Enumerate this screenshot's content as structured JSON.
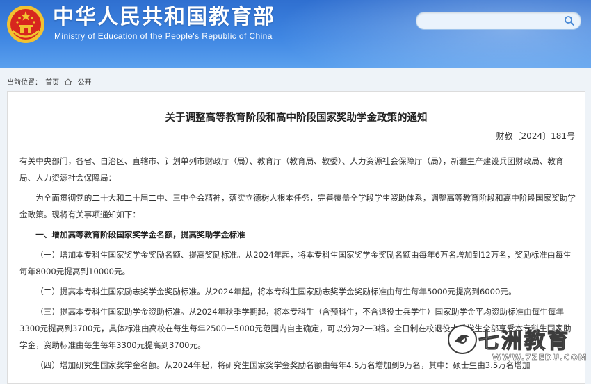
{
  "header": {
    "site_title": "中华人民共和国教育部",
    "site_subtitle": "Ministry of Education of the People's Republic of China",
    "search_placeholder": ""
  },
  "breadcrumb": {
    "prefix": "当前位置：",
    "home": "首页",
    "current": "公开"
  },
  "article": {
    "title": "关于调整高等教育阶段和高中阶段国家奖助学金政策的通知",
    "doc_number": "财教〔2024〕181号",
    "addressee": "有关中央部门，各省、自治区、直辖市、计划单列市财政厅（局）、教育厅（教育局、教委）、人力资源社会保障厅（局），新疆生产建设兵团财政局、教育局、人力资源社会保障局：",
    "intro": "为全面贯彻党的二十大和二十届二中、三中全会精神，落实立德树人根本任务，完善覆盖全学段学生资助体系，调整高等教育阶段和高中阶段国家奖助学金政策。现将有关事项通知如下：",
    "section1_heading": "一、增加高等教育阶段国家奖学金名额，提高奖助学金标准",
    "item1": "（一）增加本专科生国家奖学金奖励名额、提高奖励标准。从2024年起，将本专科生国家奖学金奖励名额由每年6万名增加到12万名，奖励标准由每生每年8000元提高到10000元。",
    "item2": "（二）提高本专科生国家励志奖学金奖励标准。从2024年起，将本专科生国家励志奖学金奖励标准由每生每年5000元提高到6000元。",
    "item3": "（三）提高本专科生国家助学金资助标准。从2024年秋季学期起，将本专科生（含预科生，不含退役士兵学生）国家助学金平均资助标准由每生每年3300元提高到3700元，具体标准由高校在每生每年2500—5000元范围内自主确定，可以分为2—3档。全日制在校退役士兵学生全部享受本专科生国家助学金，资助标准由每生每年3300元提高到3700元。",
    "item4": "（四）增加研究生国家奖学金名额。从2024年起，将研究生国家奖学金奖励名额由每年4.5万名增加到9万名，其中：硕士生由3.5万名增加"
  },
  "watermark": {
    "text": "七洲教育",
    "url": "WWW.7ZEDU.COM"
  },
  "colors": {
    "header_blue": "#3f86e2",
    "emblem_red": "#d7261e",
    "emblem_gold": "#f2c230"
  }
}
